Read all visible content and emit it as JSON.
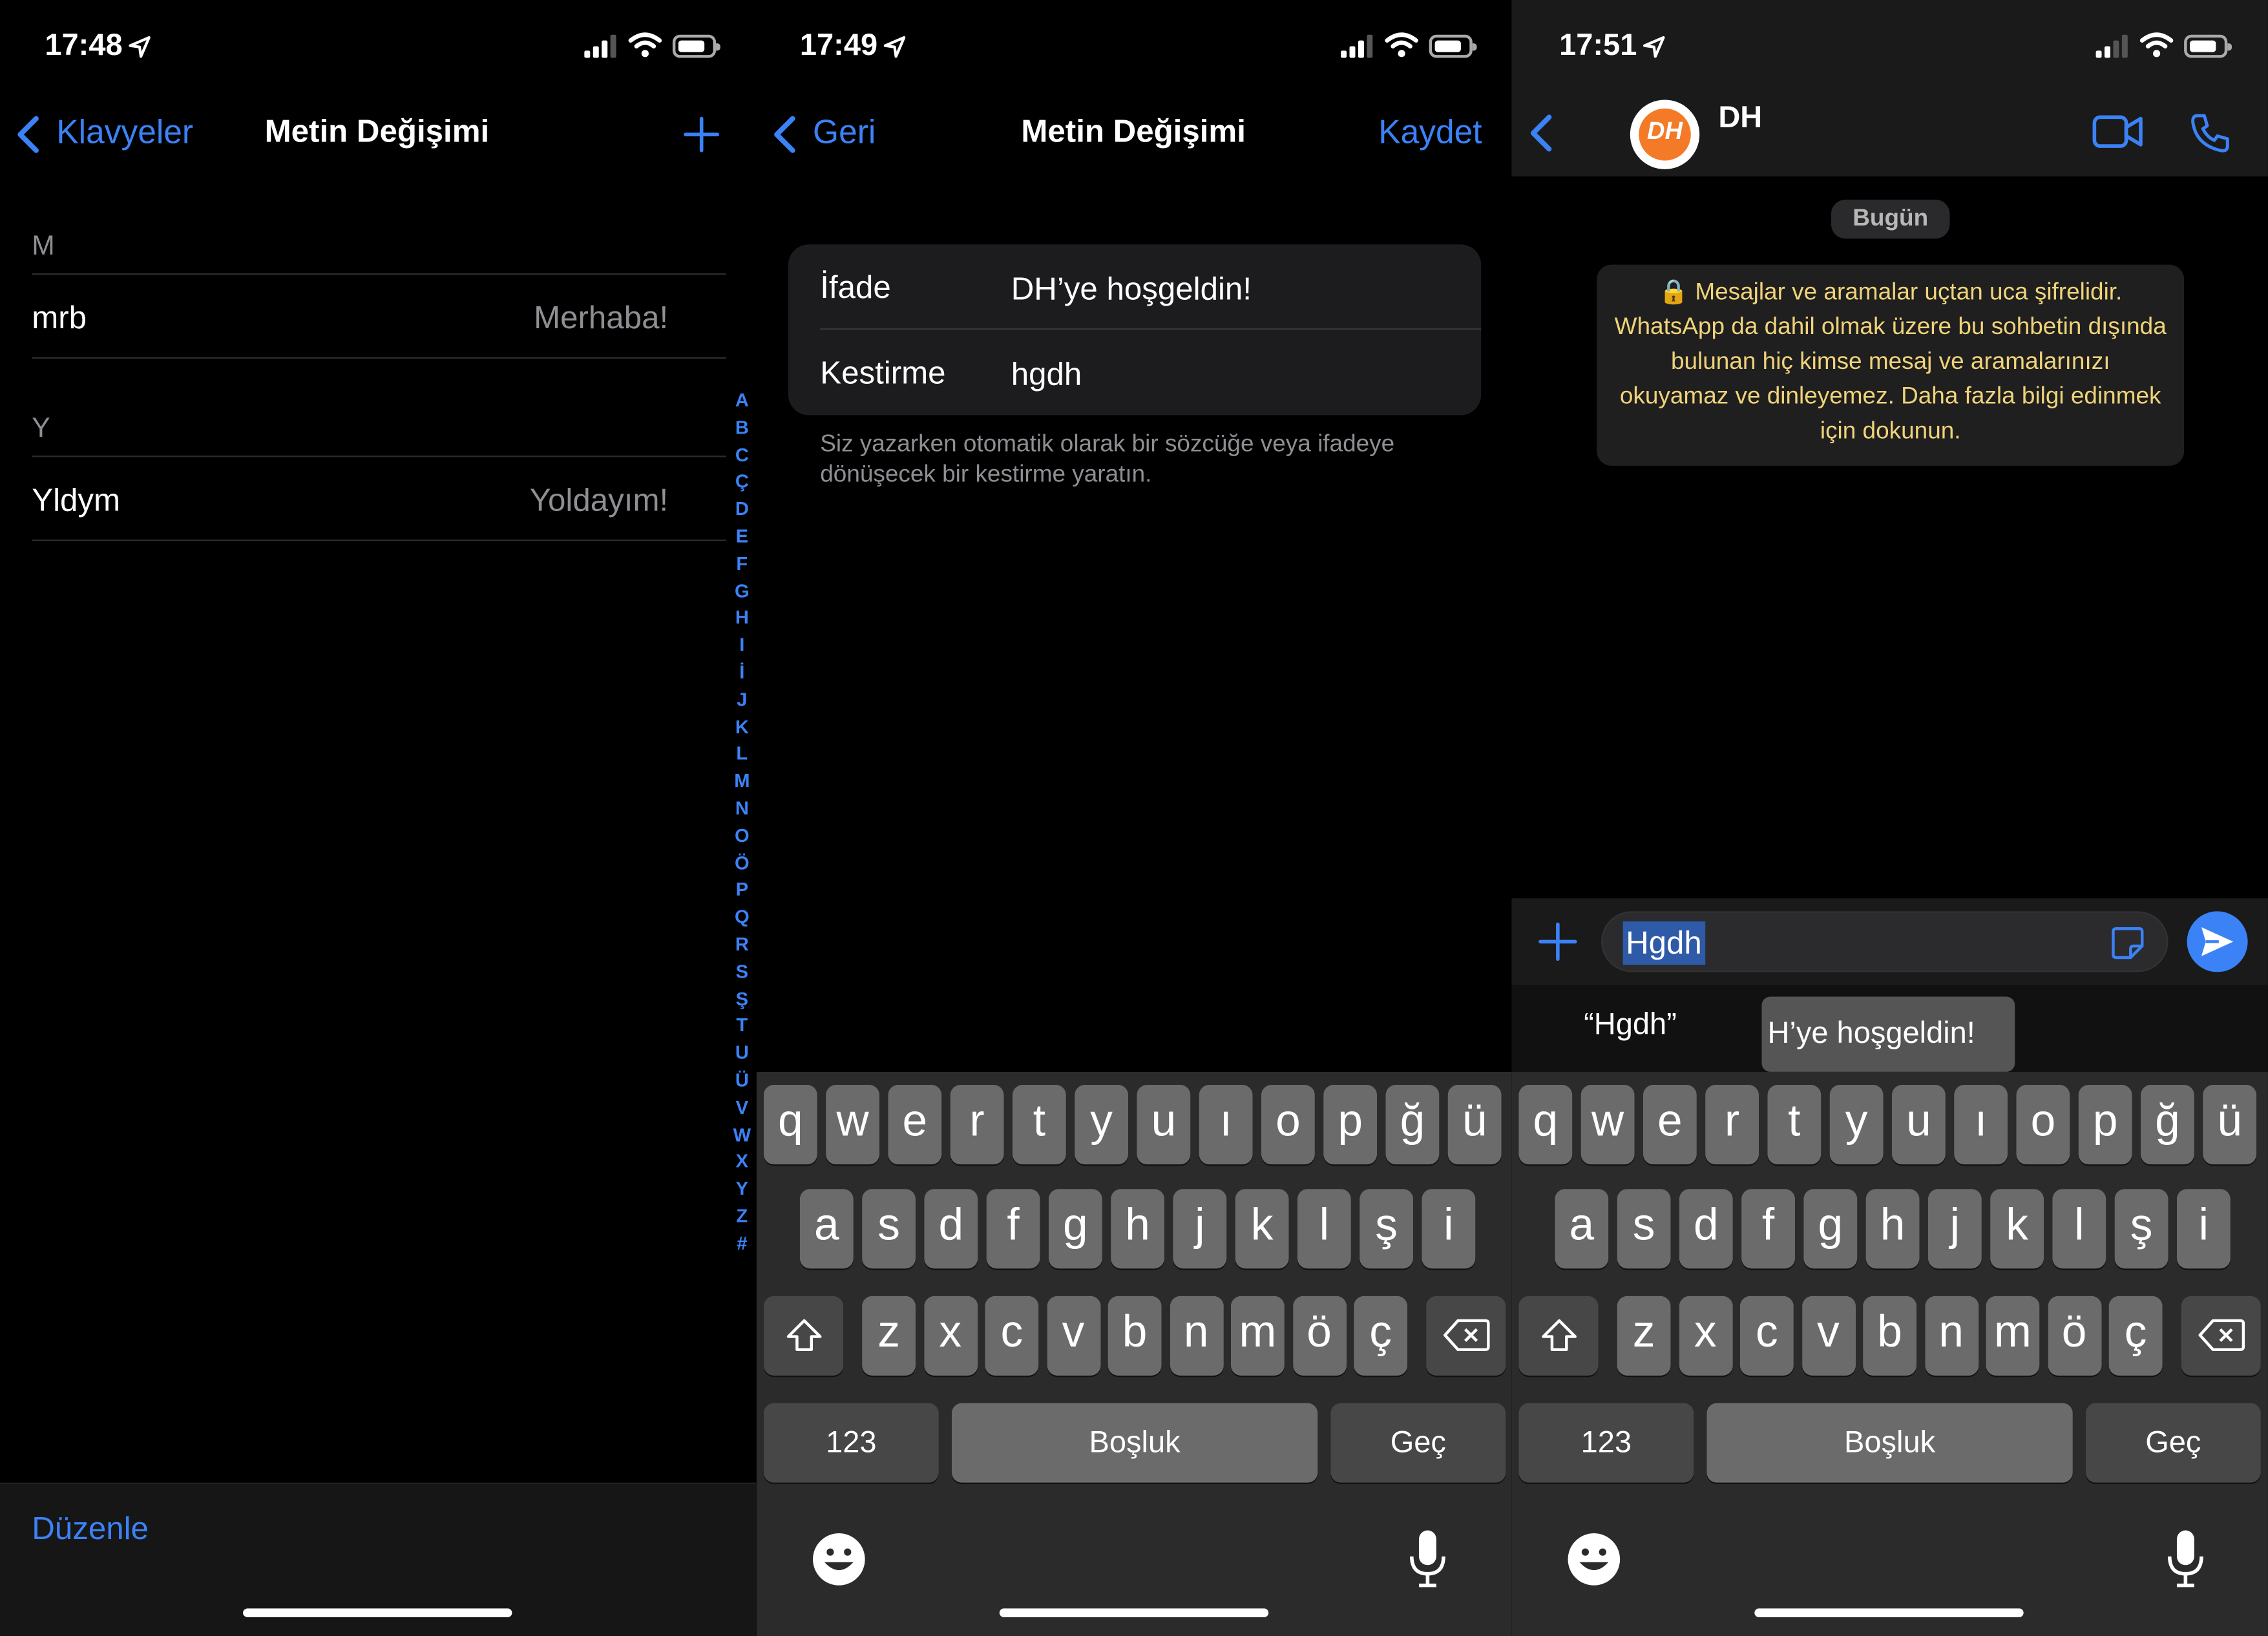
{
  "panel1": {
    "time": "17:48",
    "back_label": "Klavyeler",
    "title": "Metin Değişimi",
    "add_label": "+",
    "sections": [
      {
        "header": "M",
        "shortcut": "mrb",
        "phrase": "Merhaba!"
      },
      {
        "header": "Y",
        "shortcut": "Yldym",
        "phrase": "Yoldayım!"
      }
    ],
    "index": [
      "A",
      "B",
      "C",
      "Ç",
      "D",
      "E",
      "F",
      "G",
      "H",
      "I",
      "İ",
      "J",
      "K",
      "L",
      "M",
      "N",
      "O",
      "Ö",
      "P",
      "Q",
      "R",
      "S",
      "Ş",
      "T",
      "U",
      "Ü",
      "V",
      "W",
      "X",
      "Y",
      "Z",
      "#"
    ],
    "edit_label": "Düzenle"
  },
  "panel2": {
    "time": "17:49",
    "back_label": "Geri",
    "title": "Metin Değişimi",
    "save_label": "Kaydet",
    "phrase_label": "İfade",
    "phrase_value": "DH’ye hoşgeldin!",
    "shortcut_label": "Kestirme",
    "shortcut_value": "hgdh",
    "help_text": "Siz yazarken otomatik olarak bir sözcüğe veya ifadeye dönüşecek bir kestirme yaratın."
  },
  "panel3": {
    "time": "17:51",
    "contact_name": "DH",
    "avatar_text": "DH",
    "date_label": "Bugün",
    "encryption_notice": "🔒 Mesajlar ve aramalar uçtan uca şifrelidir. WhatsApp da dahil olmak üzere bu sohbetin dışında bulunan hiç kimse mesaj ve aramalarınızı okuyamaz ve dinleyemez. Daha fazla bilgi edinmek için dokunun.",
    "input_value": "Hgdh",
    "suggestion_literal": "“Hgdh”",
    "suggestion_replacement": "H’ye hoşgeldin!"
  },
  "keyboard": {
    "row1": [
      "q",
      "w",
      "e",
      "r",
      "t",
      "y",
      "u",
      "ı",
      "o",
      "p",
      "ğ",
      "ü"
    ],
    "row2": [
      "a",
      "s",
      "d",
      "f",
      "g",
      "h",
      "j",
      "k",
      "l",
      "ş",
      "i"
    ],
    "row3": [
      "z",
      "x",
      "c",
      "v",
      "b",
      "n",
      "m",
      "ö",
      "ç"
    ],
    "numbers_label": "123",
    "space_label": "Boşluk",
    "return_label": "Geç"
  },
  "colors": {
    "accent": "#3b82f6",
    "encryption_text": "#f0d37a",
    "key": "#6b6b6b",
    "key_fn": "#474747"
  }
}
